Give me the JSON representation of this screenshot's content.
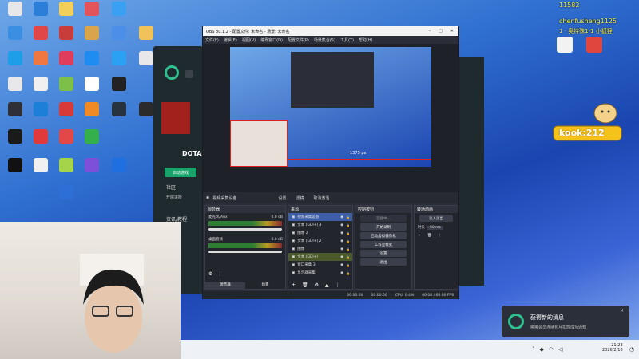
{
  "desktop_icons": [
    {
      "label": "",
      "color": "#e7e7ea"
    },
    {
      "label": "",
      "color": "#2c7fd8"
    },
    {
      "label": "",
      "color": "#f2cf58"
    },
    {
      "label": "",
      "color": "#e2545a"
    },
    {
      "label": "",
      "color": "#3aa0f2"
    },
    {
      "label": "",
      "color": "#3b8fe2"
    },
    {
      "label": "",
      "color": "#e04848"
    },
    {
      "label": "",
      "color": "#c83c3c"
    },
    {
      "label": "",
      "color": "#d9a44c"
    },
    {
      "label": "",
      "color": "#4c8fe8"
    },
    {
      "label": "",
      "color": "#f0c35a"
    },
    {
      "label": "",
      "color": "#1f9ee8"
    },
    {
      "label": "",
      "color": "#f07840"
    },
    {
      "label": "",
      "color": "#e03c5c"
    },
    {
      "label": "",
      "color": "#1e8cf0"
    },
    {
      "label": "",
      "color": "#2aa1f3"
    },
    {
      "label": "",
      "color": "#e8e8ea"
    },
    {
      "label": "",
      "color": "#e8e8ea"
    },
    {
      "label": "",
      "color": "#f0f0f0"
    },
    {
      "label": "",
      "color": "#7cc04a"
    },
    {
      "label": "",
      "color": "#ffffff"
    },
    {
      "label": "",
      "color": "#222222"
    },
    {
      "label": "",
      "color": "#2f2f38"
    },
    {
      "label": "",
      "color": "#1c7fd8"
    },
    {
      "label": "",
      "color": "#d83a3a"
    },
    {
      "label": "",
      "color": "#f08a24"
    },
    {
      "label": "",
      "color": "#27343f"
    },
    {
      "label": "",
      "color": "#2b2b2b"
    },
    {
      "label": "",
      "color": "#1a1a1a"
    },
    {
      "label": "",
      "color": "#e23a3a"
    },
    {
      "label": "",
      "color": "#e34848"
    },
    {
      "label": "",
      "color": "#33b04a"
    },
    {
      "label": "",
      "color": "#111111"
    },
    {
      "label": "",
      "color": "#f0f0f0"
    },
    {
      "label": "",
      "color": "#a4d44a"
    },
    {
      "label": "",
      "color": "#7e4fd8"
    },
    {
      "label": "",
      "color": "#1f6fe0"
    },
    {
      "label": "",
      "color": "#2d6fd6"
    }
  ],
  "overlay": {
    "line1": "11582",
    "line2": "chenfusheng1125",
    "line3": "1 · 奥特殊1-1 小狐狸"
  },
  "sticker": {
    "text": "kook:212"
  },
  "obs": {
    "title": "OBS 30.1.2 - 配置文件: 未命名 - 场景: 未命名",
    "menu": [
      "文件(F)",
      "编辑(E)",
      "视图(V)",
      "停靠窗口(D)",
      "配置文件(P)",
      "场景集合(S)",
      "工具(T)",
      "帮助(H)"
    ],
    "preview_label": "1375 px",
    "srcbar": {
      "source": "视频采集设备",
      "props": "设置",
      "filters": "滤镜",
      "deactivate": "取消激活"
    },
    "mixer": {
      "title": "混音器",
      "ch1": "麦克风/Aux",
      "ch1_db": "0.0 dB",
      "ch2": "桌面音频",
      "ch2_db": "0.0 dB",
      "tab1": "混音器",
      "tab2": "场景"
    },
    "sources": {
      "title": "来源",
      "items": [
        "视频采集设备",
        "文本 (GDI+) 3",
        "图像 2",
        "文本 (GDI+) 2",
        "图像",
        "文本 (GDI+)",
        "窗口采集 3",
        "显示器采集"
      ]
    },
    "controls": {
      "title": "控制按钮",
      "connecting": "连接中...",
      "start_record": "开始录制",
      "virtual_cam": "启动虚拟摄像机",
      "studio_mode": "工作室模式",
      "settings": "设置",
      "exit": "退出"
    },
    "transitions": {
      "title": "转场动画",
      "select": "淡入淡出",
      "duration_label": "时长",
      "duration": "50 ms"
    },
    "status": {
      "time1": "00:00:00",
      "time2": "00:00:00",
      "cpu": "CPU: 0.4%",
      "fps": "60.00 / 60.00 FPS"
    }
  },
  "bg_app": {
    "game": "DOTA",
    "button": "启动游戏",
    "community": "社区",
    "open_dev": "开展进阶",
    "news": "资讯/教程"
  },
  "notification": {
    "title": "获得新的消息",
    "body": "嘟嘟会员连续包月扣款成功通知"
  },
  "taskbar": {
    "time": "21:23",
    "date": "2026/2/18"
  }
}
